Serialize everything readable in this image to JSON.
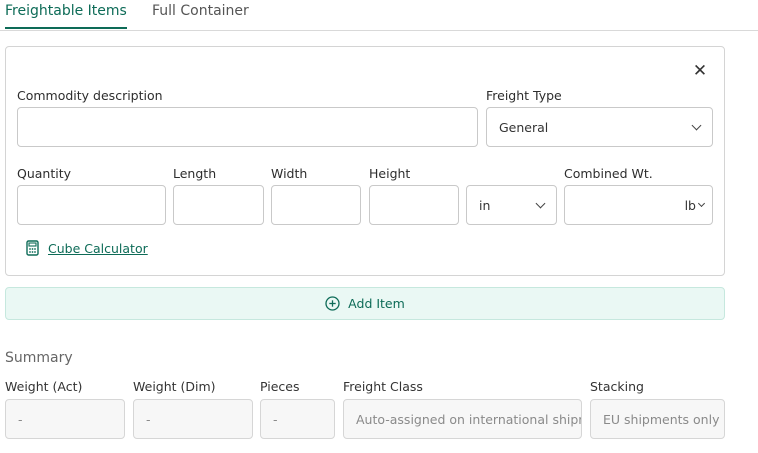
{
  "tabs": [
    {
      "label": "Freightable Items"
    },
    {
      "label": "Full Container"
    }
  ],
  "item": {
    "commodity_label": "Commodity description",
    "commodity_value": "",
    "freight_type_label": "Freight Type",
    "freight_type_value": "General",
    "quantity_label": "Quantity",
    "length_label": "Length",
    "width_label": "Width",
    "height_label": "Height",
    "dimension_unit": "in",
    "combined_wt_label": "Combined Wt.",
    "weight_unit": "lb",
    "cube_calculator_label": "Cube Calculator",
    "close_symbol": "✕"
  },
  "add_item_label": "Add Item",
  "summary": {
    "title": "Summary",
    "weight_act_label": "Weight (Act)",
    "weight_act_value": "-",
    "weight_dim_label": "Weight (Dim)",
    "weight_dim_value": "-",
    "pieces_label": "Pieces",
    "pieces_value": "-",
    "freight_class_label": "Freight Class",
    "freight_class_placeholder": "Auto-assigned on international shipme",
    "stacking_label": "Stacking",
    "stacking_placeholder": "EU shipments only"
  },
  "colors": {
    "accent": "#0d6b57",
    "add_item_bg": "#eaf8f4",
    "border": "#c9c9c9"
  },
  "icons": [
    "close-icon",
    "chevron-down-icon",
    "calculator-icon",
    "plus-circle-icon"
  ]
}
